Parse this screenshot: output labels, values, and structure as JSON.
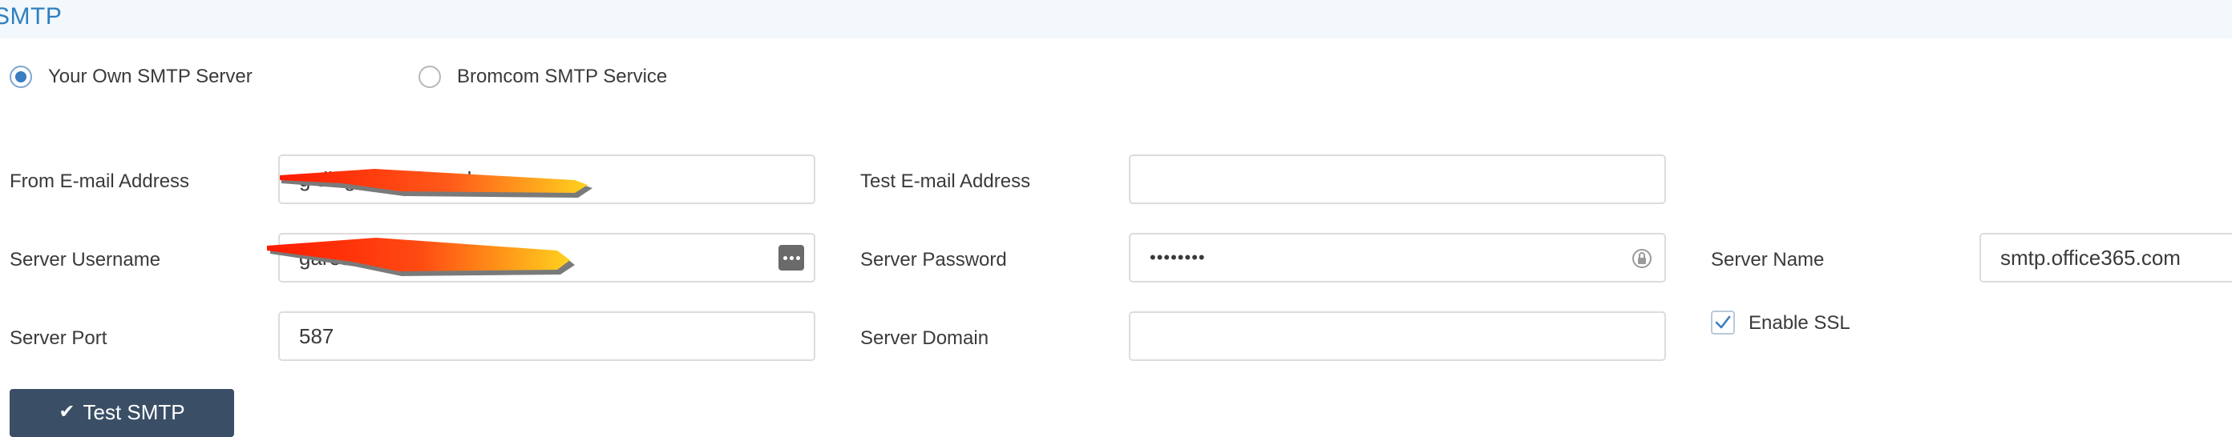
{
  "header": {
    "title": "SMTP"
  },
  "smtp_mode": {
    "options": [
      {
        "label": "Your Own SMTP Server",
        "selected": true
      },
      {
        "label": "Bromcom SMTP Service",
        "selected": false
      }
    ]
  },
  "form": {
    "from_email": {
      "label": "From E-mail Address",
      "value": "g           ding.school.co.uk"
    },
    "test_email": {
      "label": "Test E-mail Address",
      "value": ""
    },
    "server_username": {
      "label": "Server Username",
      "value": "gareth@               l.co.uk"
    },
    "server_password": {
      "label": "Server Password",
      "value": "••••••••"
    },
    "server_name": {
      "label": "Server Name",
      "value": "smtp.office365.com"
    },
    "server_port": {
      "label": "Server Port",
      "value": "587"
    },
    "server_domain": {
      "label": "Server Domain",
      "value": ""
    },
    "enable_ssl": {
      "label": "Enable SSL",
      "checked": true
    }
  },
  "actions": {
    "test_smtp_label": "Test SMTP"
  },
  "icons": {
    "username_field_icon": "more-dots-icon",
    "password_field_icon": "password-reveal-icon",
    "ssl_checkbox_icon": "checkmark-icon",
    "test_button_icon": "checkmark-icon"
  },
  "colors": {
    "accent": "#2f7fbf",
    "radio_selected": "#3a7dc2",
    "button_bg": "#3a4f66",
    "header_bg": "#f2f8fc",
    "redaction_red": "#ff1a00",
    "redaction_yellow": "#ffd21f"
  }
}
